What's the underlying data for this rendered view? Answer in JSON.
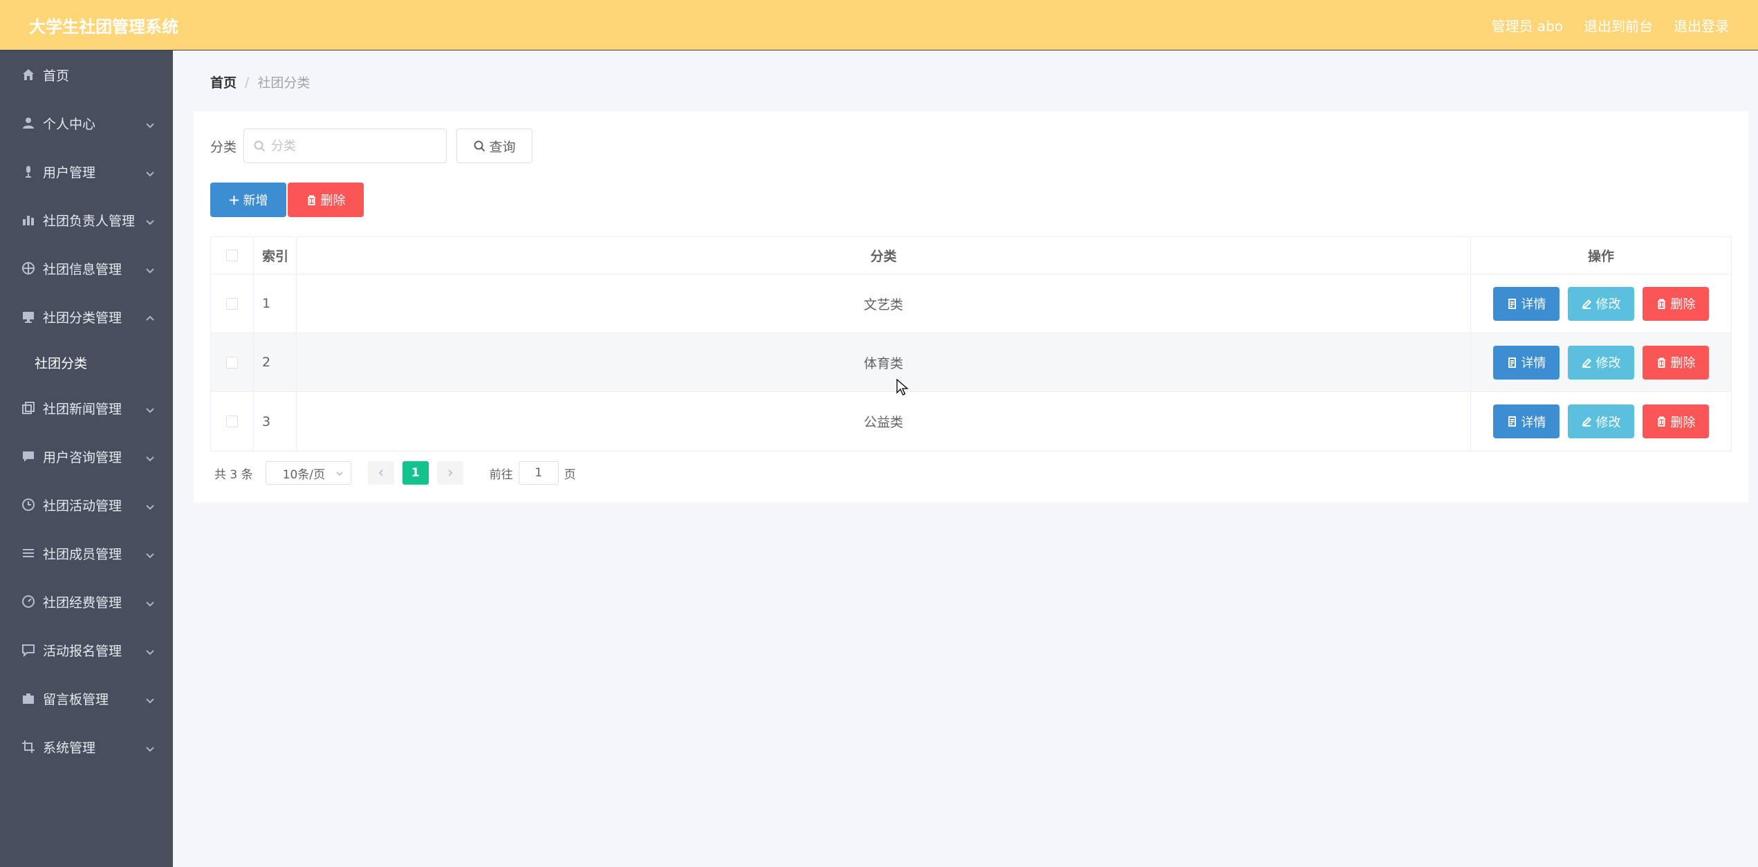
{
  "header": {
    "title": "大学生社团管理系统",
    "user_label": "管理员 abo",
    "to_front_label": "退出到前台",
    "logout_label": "退出登录"
  },
  "sidebar": {
    "items": [
      {
        "label": "首页",
        "icon": "home-icon"
      },
      {
        "label": "个人中心",
        "icon": "user-icon"
      },
      {
        "label": "用户管理",
        "icon": "microphone-icon"
      },
      {
        "label": "社团负责人管理",
        "icon": "bar-chart-icon"
      },
      {
        "label": "社团信息管理",
        "icon": "target-icon"
      },
      {
        "label": "社团分类管理",
        "icon": "monitor-icon",
        "expanded": true,
        "children": [
          "社团分类"
        ]
      },
      {
        "label": "社团新闻管理",
        "icon": "copy-icon"
      },
      {
        "label": "用户咨询管理",
        "icon": "chat-icon"
      },
      {
        "label": "社团活动管理",
        "icon": "clock-icon"
      },
      {
        "label": "社团成员管理",
        "icon": "list-icon"
      },
      {
        "label": "社团经费管理",
        "icon": "gauge-icon"
      },
      {
        "label": "活动报名管理",
        "icon": "message-icon"
      },
      {
        "label": "留言板管理",
        "icon": "briefcase-icon"
      },
      {
        "label": "系统管理",
        "icon": "crop-icon"
      }
    ]
  },
  "breadcrumb": {
    "home": "首页",
    "separator": "/",
    "current": "社团分类"
  },
  "search": {
    "label": "分类",
    "placeholder": "分类",
    "query_label": "查询"
  },
  "toolbar": {
    "add_label": "新增",
    "delete_label": "删除"
  },
  "table": {
    "headers": {
      "index": "索引",
      "category": "分类",
      "actions": "操作"
    },
    "rows": [
      {
        "index": "1",
        "category": "文艺类"
      },
      {
        "index": "2",
        "category": "体育类"
      },
      {
        "index": "3",
        "category": "公益类"
      }
    ],
    "row_actions": {
      "detail": "详情",
      "edit": "修改",
      "delete": "删除"
    }
  },
  "pagination": {
    "total": "共 3 条",
    "page_size": "10条/页",
    "current_page": "1",
    "goto_prefix": "前往",
    "goto_value": "1",
    "goto_suffix": "页"
  },
  "colors": {
    "header_bg": "#ffd677",
    "sidebar_bg": "#474e5d",
    "primary_blue": "#3c8dd2",
    "danger_red": "#fa5656",
    "info_cyan": "#5bc0de",
    "page_active": "#13c28d"
  }
}
